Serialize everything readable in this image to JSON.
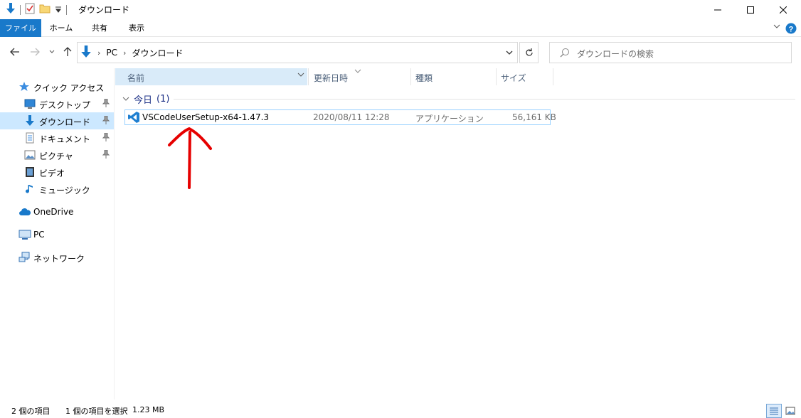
{
  "window": {
    "title": "ダウンロード",
    "controls": {
      "minimize": "—",
      "maximize": "☐",
      "close": "✕"
    }
  },
  "ribbon": {
    "tabs": [
      "ファイル",
      "ホーム",
      "共有",
      "表示"
    ],
    "help": "?"
  },
  "address_bar": {
    "crumbs": [
      "PC",
      "ダウンロード"
    ]
  },
  "search": {
    "placeholder": "ダウンロードの検索"
  },
  "sidebar": {
    "quick_access": "クイック アクセス",
    "items": [
      {
        "label": "デスクトップ",
        "icon": "desktop-icon",
        "pinned": true
      },
      {
        "label": "ダウンロード",
        "icon": "download-icon",
        "pinned": true,
        "selected": true
      },
      {
        "label": "ドキュメント",
        "icon": "document-icon",
        "pinned": true
      },
      {
        "label": "ピクチャ",
        "icon": "pictures-icon",
        "pinned": true
      },
      {
        "label": "ビデオ",
        "icon": "video-icon",
        "pinned": false
      },
      {
        "label": "ミュージック",
        "icon": "music-icon",
        "pinned": false
      }
    ],
    "onedrive": "OneDrive",
    "pc": "PC",
    "network": "ネットワーク"
  },
  "columns": [
    "名前",
    "更新日時",
    "種類",
    "サイズ"
  ],
  "group": {
    "label": "今日",
    "count": "(1)"
  },
  "files": [
    {
      "name": "VSCodeUserSetup-x64-1.47.3",
      "modified": "2020/08/11 12:28",
      "type": "アプリケーション",
      "size": "56,161 KB",
      "icon": "vscode-icon"
    }
  ],
  "statusbar": {
    "count": "2 個の項目",
    "selection": "1 個の項目を選択",
    "size": "1.23 MB"
  },
  "colors": {
    "accent": "#1979ca",
    "selected": "#cce8ff",
    "annotation": "#e60000"
  }
}
